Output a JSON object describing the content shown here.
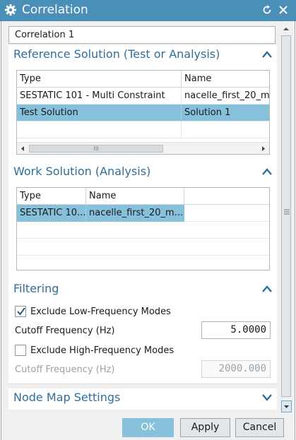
{
  "window": {
    "title": "Correlation"
  },
  "name_field": {
    "value": "Correlation 1"
  },
  "reference_solution": {
    "title": "Reference Solution (Test or Analysis)",
    "columns": [
      "Type",
      "Name"
    ],
    "rows": [
      {
        "type": "SESTATIC 101 - Multi Constraint",
        "name": "nacelle_first_20_m"
      },
      {
        "type": "Test Solution",
        "name": "Solution 1",
        "selected": true
      }
    ],
    "scroll_thumb_label": "III"
  },
  "work_solution": {
    "title": "Work Solution (Analysis)",
    "columns": [
      "Type",
      "Name"
    ],
    "rows": [
      {
        "type": "SESTATIC 10...",
        "name": "nacelle_first_20_m...",
        "selected": true
      }
    ]
  },
  "filtering": {
    "title": "Filtering",
    "exclude_low": {
      "label": "Exclude Low-Frequency Modes",
      "checked": true
    },
    "cutoff_low": {
      "label": "Cutoff Frequency (Hz)",
      "value": "5.0000"
    },
    "exclude_high": {
      "label": "Exclude High-Frequency Modes",
      "checked": false
    },
    "cutoff_high": {
      "label": "Cutoff Frequency (Hz)",
      "value": "2000.000"
    }
  },
  "node_map": {
    "title": "Node Map Settings"
  },
  "buttons": {
    "ok": "OK",
    "apply": "Apply",
    "cancel": "Cancel"
  },
  "icons": [
    "gear-icon",
    "reset-icon",
    "close-icon",
    "collapse-up-icon",
    "expand-down-icon",
    "checkmark-icon"
  ],
  "colors": {
    "titlebar": "#4a8fb8",
    "group_title": "#2e6f9e",
    "selection": "#86c0da"
  }
}
